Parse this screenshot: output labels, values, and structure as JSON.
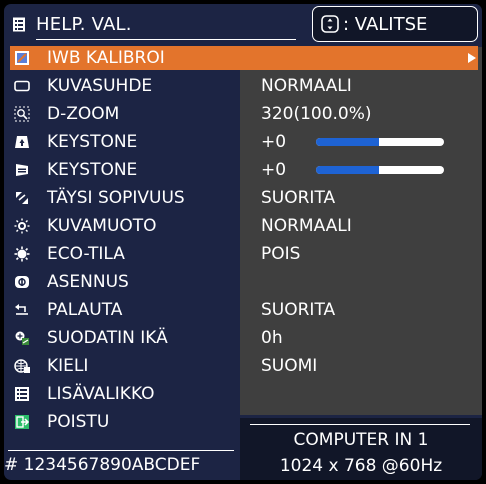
{
  "header": {
    "title": "HELP. VAL.",
    "select_label": ": VALITSE"
  },
  "menu": [
    {
      "label": "IWB KALIBROI",
      "value": "",
      "icon": "calibrate-icon",
      "selected": true,
      "has_arrow": true
    },
    {
      "label": "KUVASUHDE",
      "value": "NORMAALI",
      "icon": "aspect-icon"
    },
    {
      "label": "D-ZOOM",
      "value": "320(100.0%)",
      "icon": "zoom-icon"
    },
    {
      "label": "KEYSTONE",
      "value": "+0",
      "icon": "keystone-v-icon",
      "slider": 0.5
    },
    {
      "label": "KEYSTONE",
      "value": "+0",
      "icon": "keystone-h-icon",
      "slider": 0.5
    },
    {
      "label": "TÄYSI SOPIVUUS",
      "value": "SUORITA",
      "icon": "perfect-fit-icon"
    },
    {
      "label": "KUVAMUOTO",
      "value": "NORMAALI",
      "icon": "picture-mode-icon"
    },
    {
      "label": "ECO-TILA",
      "value": "POIS",
      "icon": "eco-icon"
    },
    {
      "label": "ASENNUS",
      "value": "",
      "icon": "installation-icon"
    },
    {
      "label": "PALAUTA",
      "value": "SUORITA",
      "icon": "reset-icon"
    },
    {
      "label": "SUODATIN IKÄ",
      "value": "0h",
      "icon": "filter-icon"
    },
    {
      "label": "KIELI",
      "value": "SUOMI",
      "icon": "language-icon"
    },
    {
      "label": "LISÄVALIKKO",
      "value": "",
      "icon": "advanced-menu-icon"
    },
    {
      "label": "POISTU",
      "value": "",
      "icon": "exit-icon"
    }
  ],
  "footer": {
    "serial": "# 1234567890ABCDEF",
    "input_source": "COMPUTER IN 1",
    "signal": "1024 x 768 @60Hz"
  },
  "colors": {
    "panel_bg": "#1c2444",
    "selected_bg": "#e3742c",
    "value_bg": "#3f3f3f",
    "slider_fill": "#1e63d4"
  }
}
